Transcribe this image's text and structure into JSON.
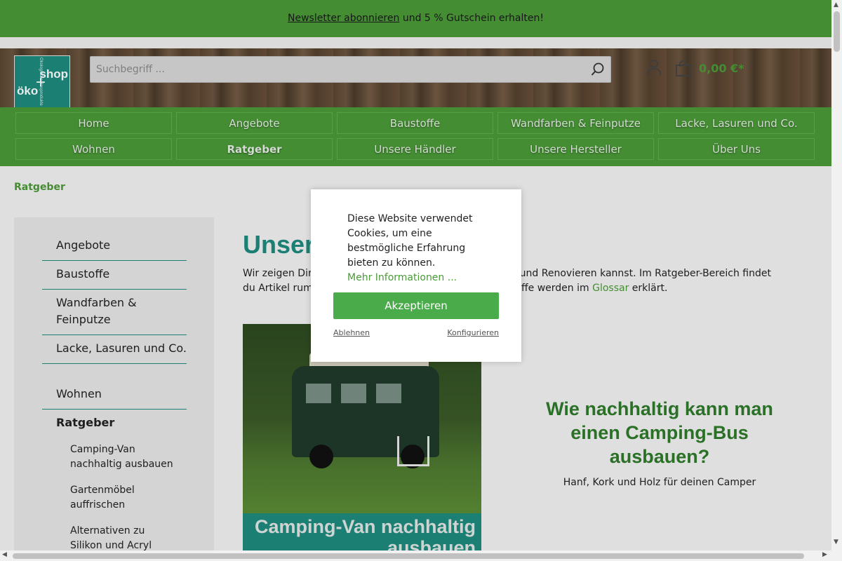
{
  "topbar": {
    "link": "Newsletter abonnieren",
    "text": " und 5 % Gutschein erhalten!"
  },
  "logo": {
    "word1": "shop",
    "word2": "öko",
    "plus": "+",
    "side": "Ökologische Bauprodukte"
  },
  "search": {
    "placeholder": "Suchbegriff ..."
  },
  "cart": {
    "value": "0,00 €*"
  },
  "nav": {
    "row1": [
      "Home",
      "Angebote",
      "Baustoffe",
      "Wandfarben & Feinputze",
      "Lacke, Lasuren und Co."
    ],
    "row2": [
      "Wohnen",
      "Ratgeber",
      "Unsere Händler",
      "Unsere Hersteller",
      "Über Uns"
    ]
  },
  "breadcrumb": "Ratgeber",
  "sidebar": {
    "items": [
      "Angebote",
      "Baustoffe",
      "Wandfarben & Feinputze",
      "Lacke, Lasuren und Co.",
      "Wohnen",
      "Ratgeber"
    ],
    "sub": [
      "Camping-Van nachhaltig ausbauen",
      "Gartenmöbel auffrischen",
      "Alternativen zu Silikon und Acryl"
    ]
  },
  "main": {
    "title": "Unser Ratgeber",
    "intro_a": "Wir zeigen Dir, wie du nachhaltig und ökologisch Bauen und Renovieren kannst. Im Ratgeber-Bereich findet du Artikel rum um's ökologische Wohnen. Wichtige Begriffe werden im ",
    "intro_link": "Glossar",
    "intro_b": " erklärt.",
    "image_caption": "Camping-Van nachhaltig ausbauen",
    "teaser_title": "Wie nachhaltig kann man einen Camping-Bus ausbauen?",
    "teaser_sub": "Hanf, Kork und Holz für deinen Camper"
  },
  "cookie": {
    "message": "Diese Website verwendet Cookies, um eine bestmögliche Erfahrung bieten zu können.",
    "more": "Mehr Informationen ...",
    "accept": "Akzeptieren",
    "decline": "Ablehnen",
    "configure": "Konfigurieren"
  },
  "colors": {
    "brand_green": "#4a9a38",
    "teal": "#1f8a7e",
    "accept": "#4aab4b"
  },
  "icons": [
    "search-icon",
    "account-icon",
    "cart-icon"
  ]
}
